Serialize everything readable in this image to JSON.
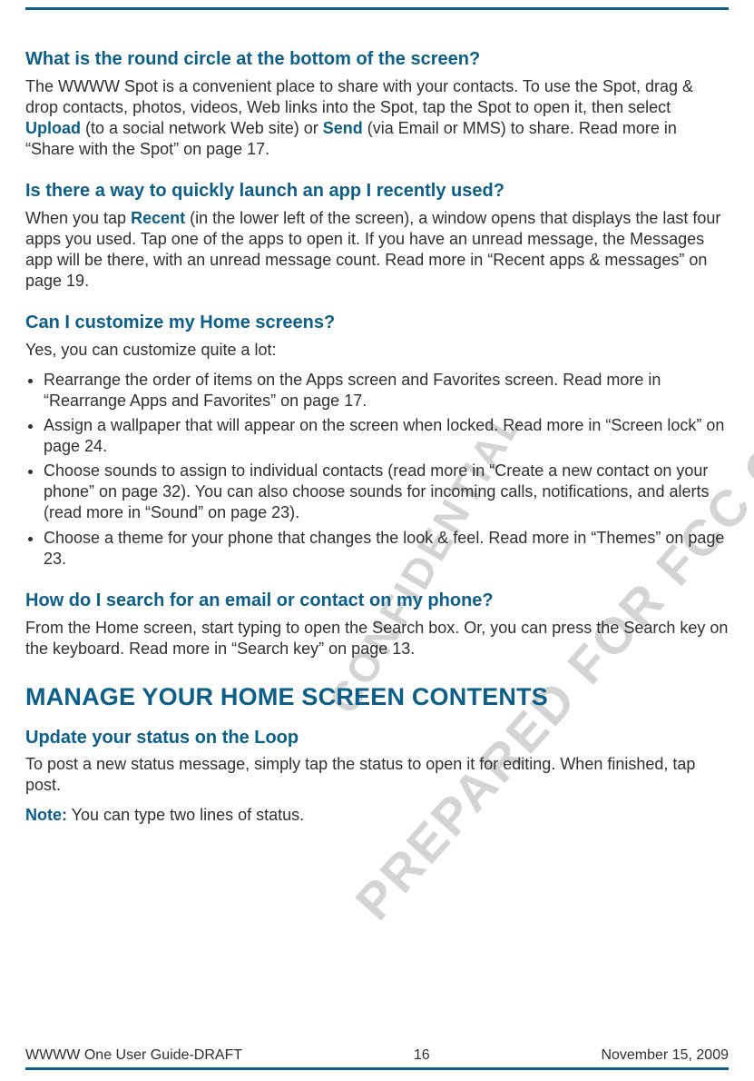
{
  "watermark": {
    "line1": "PREPARED FOR FCC CERTIFICATION",
    "line2": "CONFIDENTIAL"
  },
  "q1": {
    "title": "What is the round circle at the bottom of the screen?",
    "pre": "The WWWW Spot is a convenient place to share with your contacts. To use the Spot, drag & drop contacts, photos, videos, Web links into the Spot, tap the Spot to open it, then select ",
    "kw1": "Upload",
    "mid": " (to a social network Web site) or ",
    "kw2": "Send",
    "post": " (via Email or MMS) to share. Read more in “Share with the Spot” on page 17."
  },
  "q2": {
    "title": "Is there a way to quickly launch an app I recently used?",
    "pre": "When you tap ",
    "kw1": "Recent",
    "post": " (in the lower left of the screen), a window opens that displays the last four apps you used. Tap one of the apps to open it. If you have an unread message, the Messages app will be there, with an unread message count. Read more in “Recent apps & messages” on page 19."
  },
  "q3": {
    "title": "Can I customize my Home screens?",
    "lead": "Yes, you can customize quite a lot:",
    "bullets": [
      "Rearrange the order of items on the Apps screen and Favorites screen. Read more in “Rearrange Apps and Favorites” on page 17.",
      "Assign a wallpaper that will appear on the screen when locked. Read more in “Screen lock” on page 24.",
      "Choose sounds to assign to individual contacts (read more in “Create a new contact on your phone” on page 32). You can also choose sounds for incoming calls, notifications, and alerts (read more in “Sound” on page 23).",
      "Choose a theme for your phone that changes the look & feel. Read more in “Themes” on page 23."
    ]
  },
  "q4": {
    "title": "How do I search for an email or contact on my phone?",
    "body": "From the Home screen, start typing to open the Search box. Or, you can press the Search key on the keyboard. Read more in “Search key” on page 13."
  },
  "section": {
    "title": "MANAGE YOUR HOME SCREEN CONTENTS"
  },
  "sub1": {
    "title": "Update your status on the Loop",
    "body": "To post a new status message, simply tap the status to open it for editing. When finished, tap post.",
    "note_label": "Note:",
    "note_text": " You can type two lines of status."
  },
  "footer": {
    "left": "WWWW One User Guide-DRAFT",
    "center": "16",
    "right": "November 15, 2009"
  }
}
